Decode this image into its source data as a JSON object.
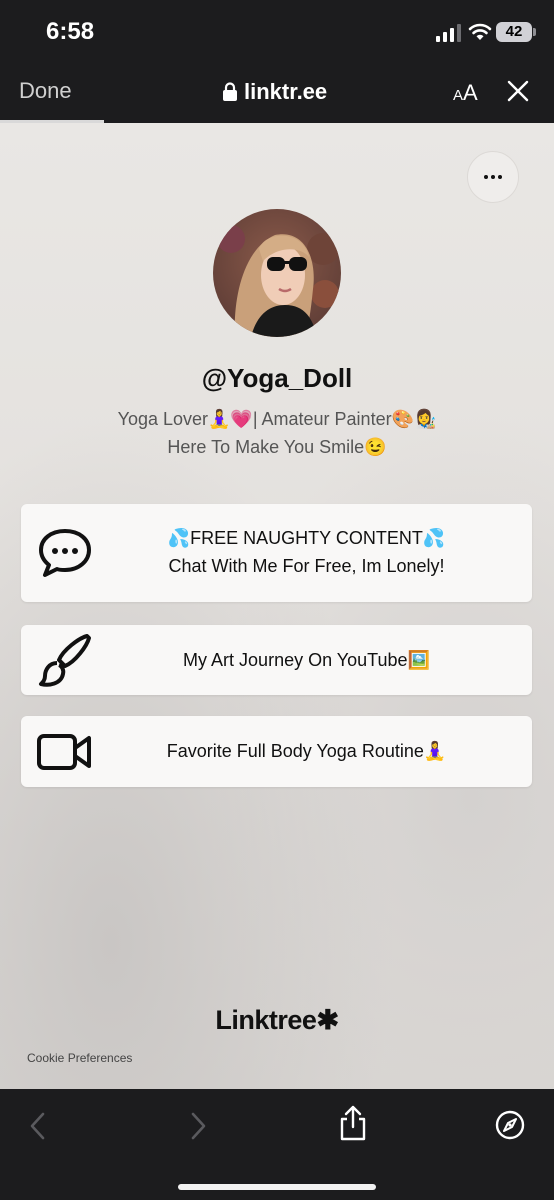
{
  "status_bar": {
    "time": "6:58",
    "battery": "42"
  },
  "nav": {
    "done_label": "Done",
    "url": "linktr.ee",
    "text_size_label": "A",
    "text_size_label_large": "A"
  },
  "profile": {
    "username": "@Yoga_Doll",
    "bio_line1": "Yoga Lover🧘‍♀️💗| Amateur Painter🎨👩‍🎨",
    "bio_line2": "Here To Make You Smile😉"
  },
  "links": [
    {
      "icon": "chat-bubble-icon",
      "line1": "💦FREE NAUGHTY CONTENT💦",
      "line2": "Chat With Me For Free, Im Lonely!"
    },
    {
      "icon": "paintbrush-icon",
      "line1": "My Art Journey On YouTube🖼️"
    },
    {
      "icon": "video-camera-icon",
      "line1": "Favorite Full Body Yoga Routine🧘‍♀️"
    }
  ],
  "footer": {
    "logo": "Linktree",
    "logo_mark": "✱",
    "cookie_label": "Cookie Preferences"
  },
  "colors": {
    "chrome": "#1c1c1e",
    "card": "#f9f8f7",
    "background": "#e6e3e0"
  }
}
